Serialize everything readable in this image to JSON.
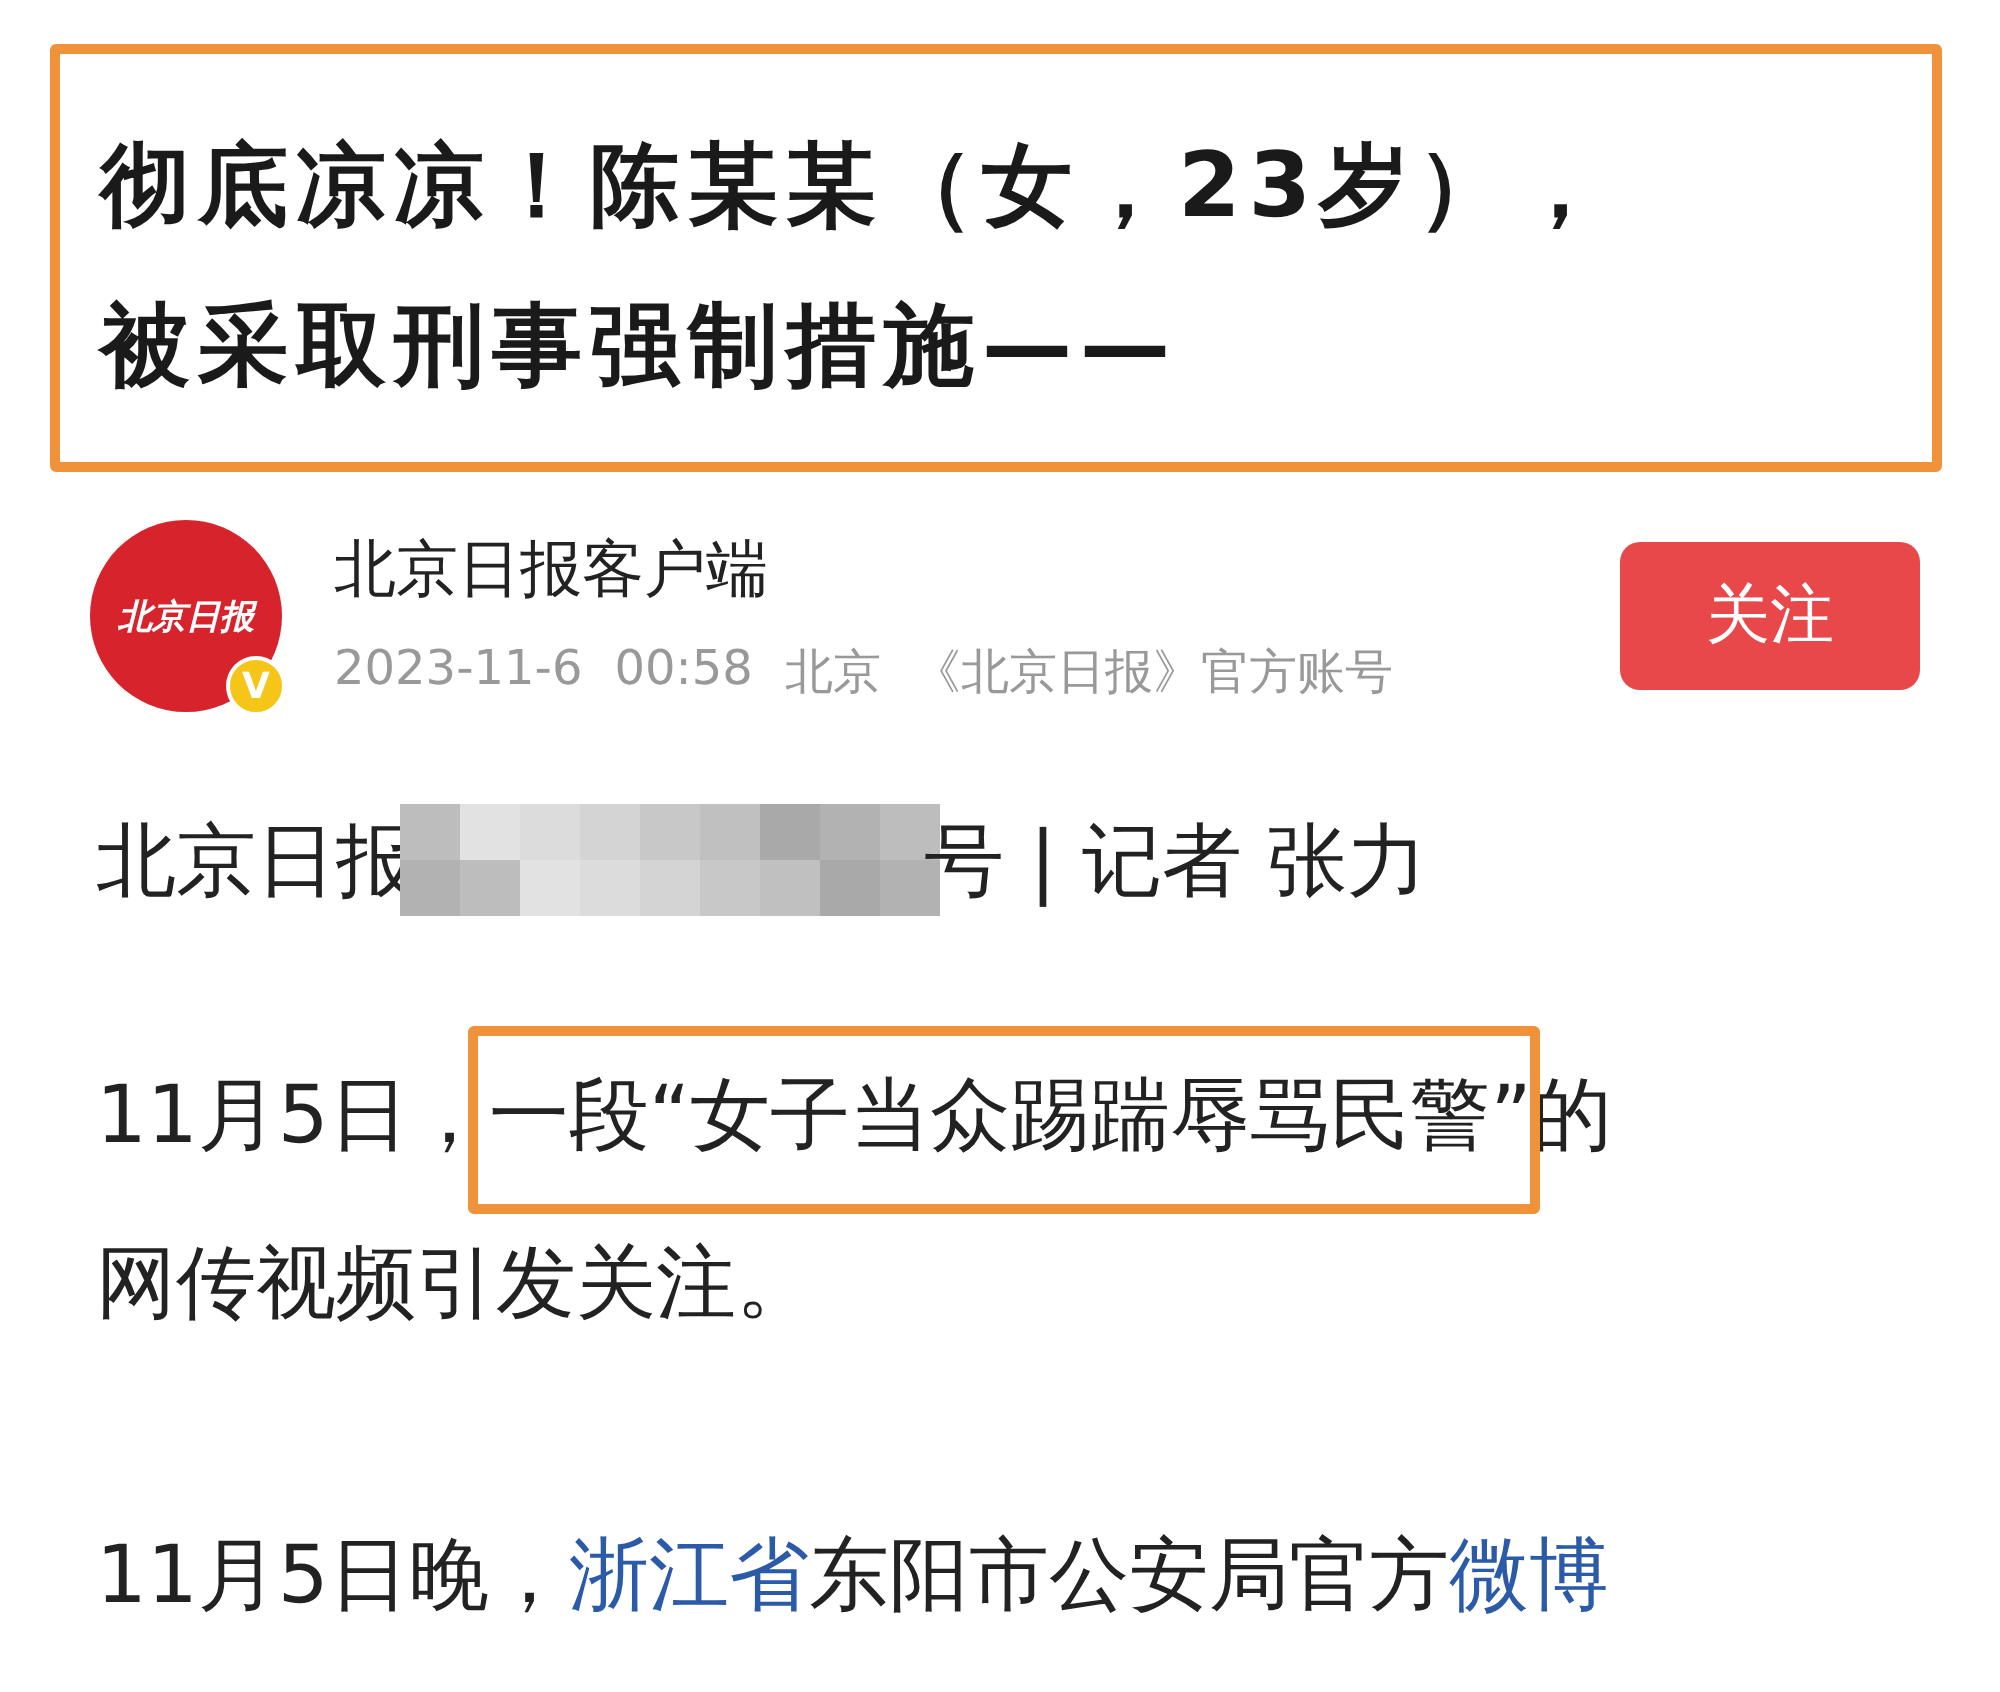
{
  "headline": "彻底凉凉！陈某某（女，23岁），被采取刑事强制措施——",
  "author": {
    "logo_text": "北京日报",
    "verified_badge": "V",
    "name": "北京日报客户端",
    "date": "2023-11-6",
    "time": "00:58",
    "location": "北京",
    "account": "《北京日报》官方账号",
    "follow_button": "关注"
  },
  "byline": {
    "before_blur": "北京日报",
    "after_blur": "号 | 记者 张力"
  },
  "paragraphs": [
    {
      "parts": [
        {
          "text": "11月5日，",
          "kind": "plain"
        },
        {
          "text": "一段“女子当众踢踹辱骂民警”",
          "kind": "highlight"
        },
        {
          "text": "的网传视频引发关注。",
          "kind": "plain"
        }
      ]
    },
    {
      "parts": [
        {
          "text": "11月5日晚，",
          "kind": "plain"
        },
        {
          "text": "浙江省",
          "kind": "link"
        },
        {
          "text": "东阳市公安局官方",
          "kind": "plain"
        },
        {
          "text": "微博",
          "kind": "link"
        }
      ]
    }
  ]
}
